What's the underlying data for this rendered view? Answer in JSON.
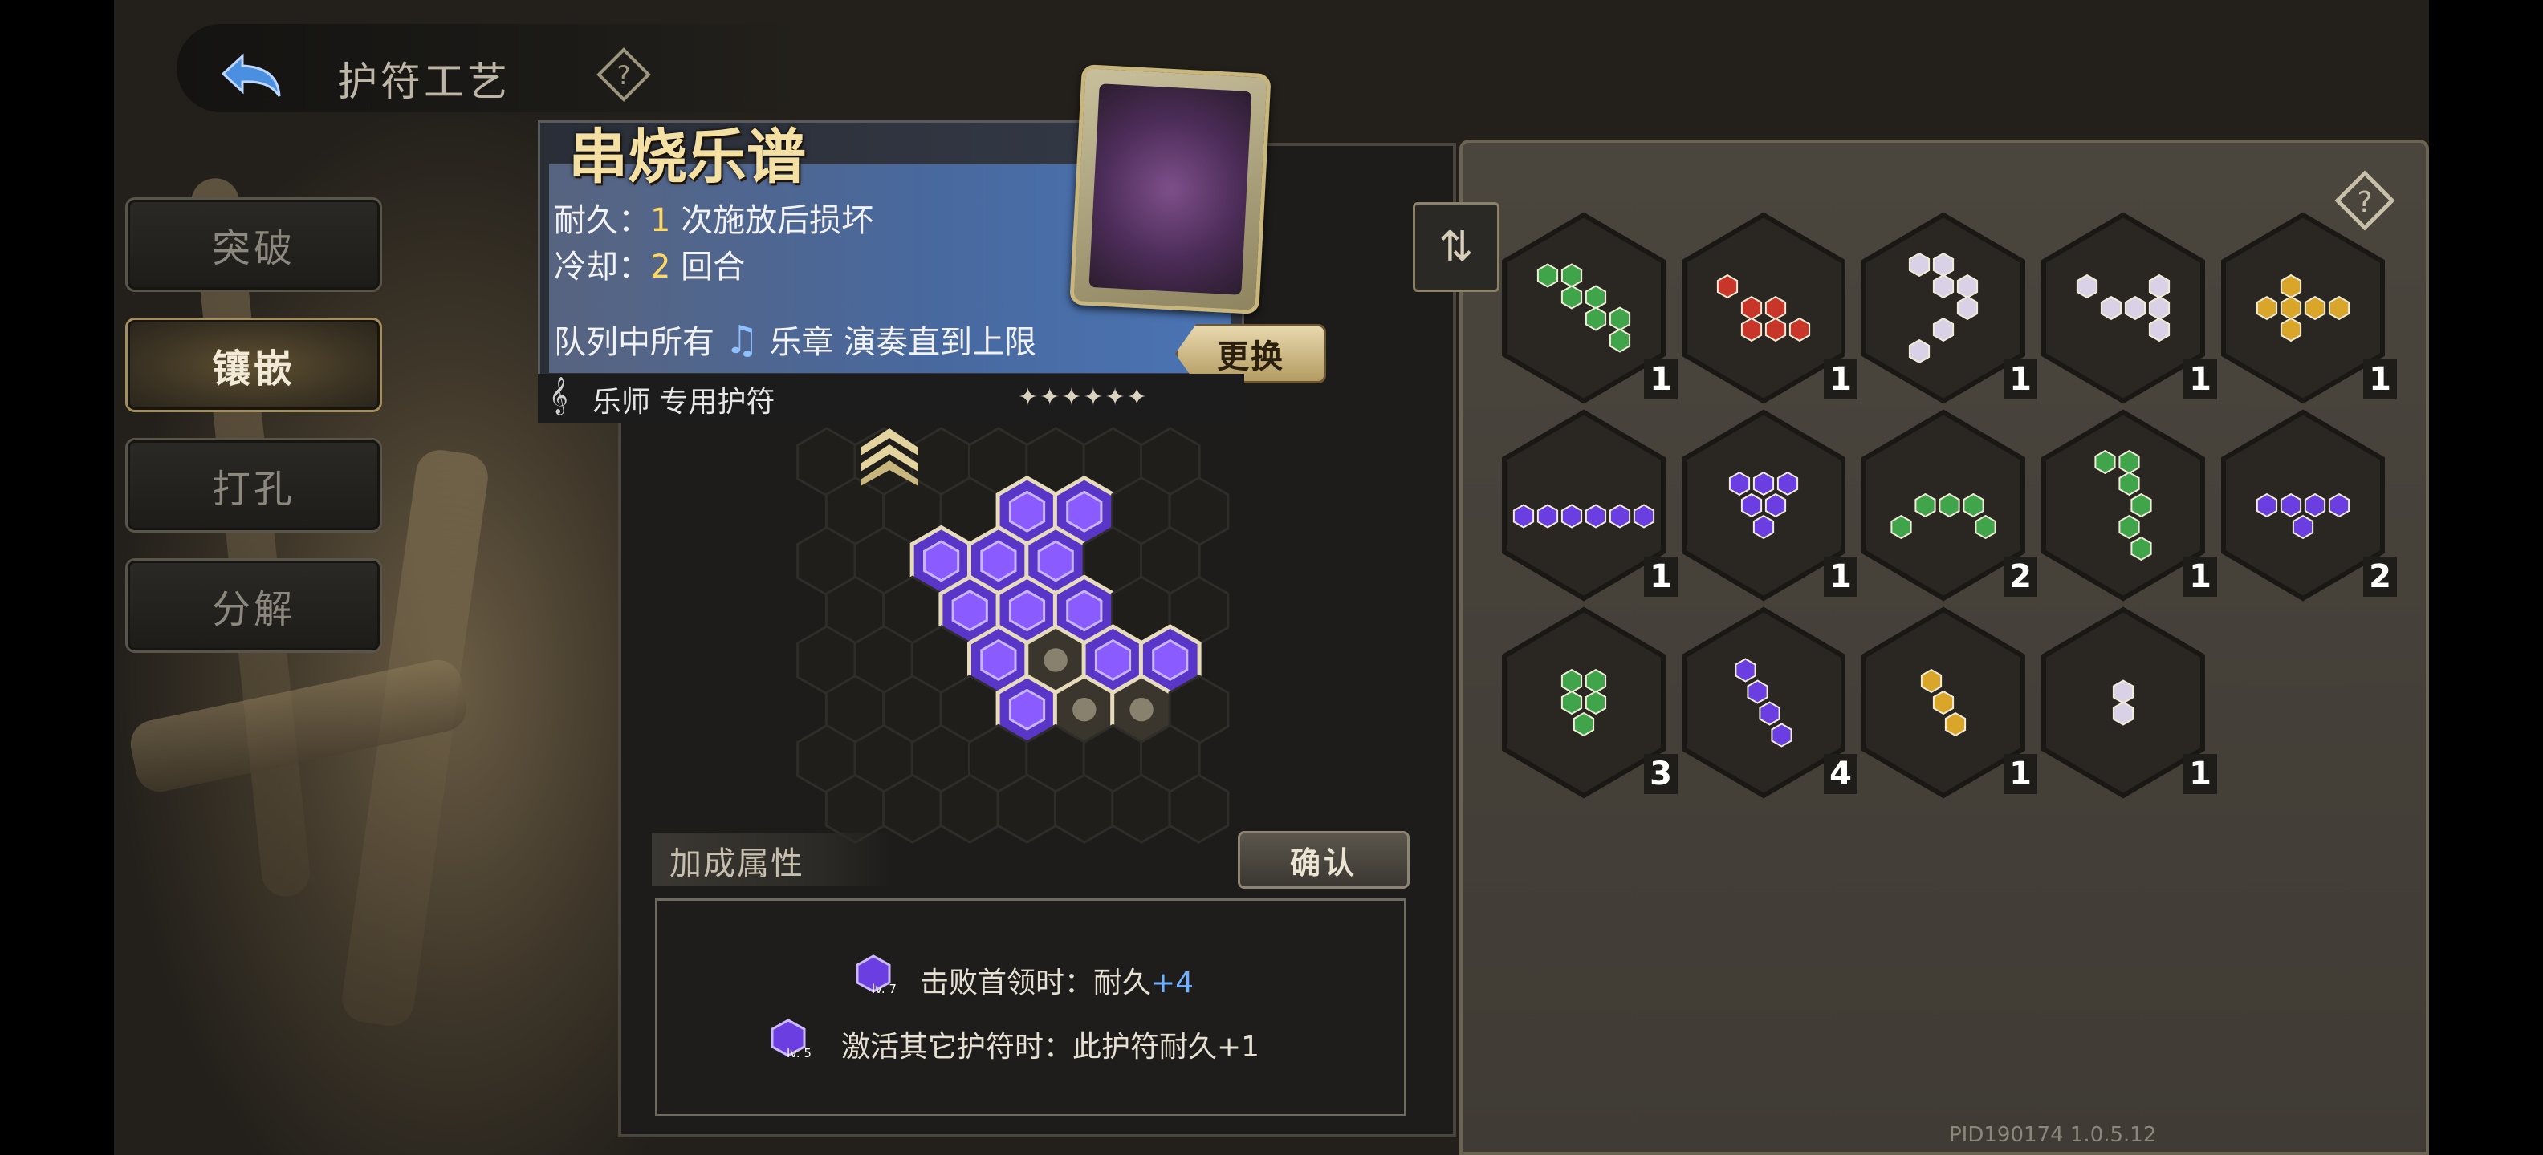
{
  "header": {
    "title": "护符工艺",
    "back_icon": "back-arrow-icon",
    "help_icon": "help-diamond-icon"
  },
  "menu": [
    {
      "label": "突破",
      "active": false
    },
    {
      "label": "镶嵌",
      "active": true
    },
    {
      "label": "打孔",
      "active": false
    },
    {
      "label": "分解",
      "active": false
    }
  ],
  "talisman": {
    "name": "串烧乐谱",
    "durability_label": "耐久：",
    "durability_value": "1",
    "durability_suffix": " 次施放后损坏",
    "cooldown_label": "冷却：",
    "cooldown_value": "2",
    "cooldown_suffix": " 回合",
    "effect_prefix": "队列中所有",
    "effect_keyword": "乐章",
    "effect_suffix": "演奏直到上限",
    "class_label": "乐师 专用护符",
    "stars": "✦✦✦✦✦✦",
    "swap_label": "更换"
  },
  "bonus": {
    "title": "加成属性",
    "confirm_label": "确认",
    "lines": [
      {
        "lv": "lv. 7",
        "text_prefix": "击败首领时：耐久",
        "text_value": "+4"
      },
      {
        "lv": "lv. 5",
        "text_prefix": "激活其它护符时：此护符耐久+1",
        "text_value": ""
      }
    ]
  },
  "inventory": {
    "sort_icon": "sort-icon",
    "help_icon": "help-diamond-icon",
    "tiles": [
      {
        "color": "green",
        "count": "1"
      },
      {
        "color": "red",
        "count": "1"
      },
      {
        "color": "white",
        "count": "1"
      },
      {
        "color": "white",
        "count": "1"
      },
      {
        "color": "yellow",
        "count": "1"
      },
      {
        "color": "purple",
        "count": "1"
      },
      {
        "color": "purple",
        "count": "1"
      },
      {
        "color": "green",
        "count": "2"
      },
      {
        "color": "green",
        "count": "1"
      },
      {
        "color": "purple",
        "count": "2"
      },
      {
        "color": "green",
        "count": "3"
      },
      {
        "color": "purple",
        "count": "4"
      },
      {
        "color": "yellow",
        "count": "1"
      },
      {
        "color": "white",
        "count": "1"
      }
    ]
  },
  "colors": {
    "green": "#3fa44a",
    "red": "#c8362a",
    "white": "#d9d2e6",
    "yellow": "#d9a62a",
    "purple": "#6a3ee0",
    "accent": "#ffd860"
  },
  "version": "PID190174  1.0.5.12"
}
